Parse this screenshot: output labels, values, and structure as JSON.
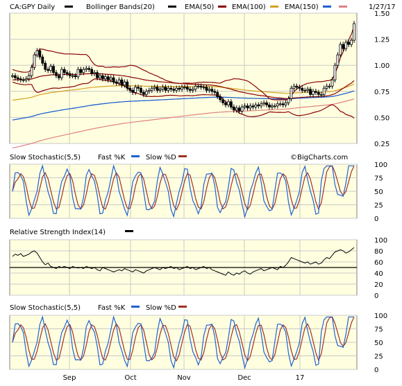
{
  "chart_data": {
    "type": "line",
    "symbol": "CA:GPY Daily",
    "date": "1/27/17",
    "watermark": "©BigCharts.com",
    "x_ticks": [
      "Sep",
      "Oct",
      "Nov",
      "Dec",
      "17"
    ],
    "panels": {
      "price": {
        "legend": [
          {
            "label": "CA:GPY Daily",
            "color": "#000000"
          },
          {
            "label": "Bollinger Bands(20)",
            "color": "#000000"
          },
          {
            "label": "EMA(50)",
            "color": "#8b0000"
          },
          {
            "label": "EMA(100)",
            "color": "#d4a020"
          },
          {
            "label": "EMA(150)",
            "color": "#2060d0"
          },
          {
            "label": "",
            "color": "#e08080"
          }
        ],
        "y_ticks": [
          "1.50",
          "1.25",
          "1.00",
          "0.75",
          "0.50",
          "0.25"
        ],
        "ylim": [
          0.25,
          1.5
        ],
        "close": [
          0.9,
          0.88,
          0.87,
          0.86,
          0.86,
          0.87,
          0.9,
          0.98,
          1.1,
          1.14,
          1.08,
          1.02,
          0.96,
          0.95,
          0.99,
          0.93,
          0.9,
          0.88,
          0.96,
          0.93,
          0.92,
          0.9,
          0.9,
          0.89,
          0.96,
          0.93,
          0.96,
          0.97,
          0.96,
          0.92,
          0.93,
          0.88,
          0.9,
          0.87,
          0.89,
          0.86,
          0.88,
          0.84,
          0.83,
          0.86,
          0.81,
          0.84,
          0.78,
          0.76,
          0.74,
          0.79,
          0.78,
          0.74,
          0.72,
          0.75,
          0.76,
          0.78,
          0.79,
          0.76,
          0.77,
          0.79,
          0.76,
          0.78,
          0.77,
          0.76,
          0.78,
          0.77,
          0.79,
          0.79,
          0.77,
          0.76,
          0.77,
          0.8,
          0.8,
          0.79,
          0.79,
          0.76,
          0.77,
          0.75,
          0.74,
          0.7,
          0.67,
          0.64,
          0.62,
          0.65,
          0.6,
          0.57,
          0.59,
          0.56,
          0.6,
          0.61,
          0.59,
          0.61,
          0.6,
          0.62,
          0.61,
          0.63,
          0.64,
          0.62,
          0.6,
          0.61,
          0.61,
          0.63,
          0.63,
          0.62,
          0.64,
          0.68,
          0.78,
          0.8,
          0.79,
          0.78,
          0.76,
          0.76,
          0.77,
          0.72,
          0.75,
          0.74,
          0.72,
          0.72,
          0.78,
          0.8,
          0.8,
          0.86,
          1.0,
          1.1,
          1.2,
          1.16,
          1.22,
          1.2,
          1.24,
          1.4
        ],
        "ema50": [
          0.86,
          0.861,
          0.861,
          0.862,
          0.862,
          0.863,
          0.864,
          0.868,
          0.876,
          0.885,
          0.893,
          0.898,
          0.901,
          0.904,
          0.908,
          0.909,
          0.909,
          0.909,
          0.911,
          0.912,
          0.912,
          0.912,
          0.912,
          0.911,
          0.913,
          0.914,
          0.916,
          0.918,
          0.919,
          0.919,
          0.919,
          0.918,
          0.918,
          0.916,
          0.915,
          0.913,
          0.912,
          0.909,
          0.906,
          0.904,
          0.9,
          0.898,
          0.893,
          0.888,
          0.882,
          0.878,
          0.874,
          0.868,
          0.862,
          0.858,
          0.854,
          0.851,
          0.849,
          0.845,
          0.842,
          0.84,
          0.837,
          0.835,
          0.833,
          0.83,
          0.828,
          0.826,
          0.825,
          0.823,
          0.821,
          0.819,
          0.817,
          0.816,
          0.816,
          0.815,
          0.814,
          0.812,
          0.811,
          0.809,
          0.806,
          0.802,
          0.797,
          0.79,
          0.783,
          0.778,
          0.77,
          0.762,
          0.755,
          0.747,
          0.742,
          0.737,
          0.731,
          0.726,
          0.722,
          0.717,
          0.712,
          0.709,
          0.706,
          0.702,
          0.698,
          0.694,
          0.691,
          0.688,
          0.686,
          0.683,
          0.681,
          0.68,
          0.682,
          0.686,
          0.689,
          0.69,
          0.693,
          0.694,
          0.696,
          0.697,
          0.698,
          0.699,
          0.7,
          0.701,
          0.704,
          0.707,
          0.711,
          0.718,
          0.728,
          0.743,
          0.762,
          0.779,
          0.797,
          0.813,
          0.829,
          0.853
        ]
      },
      "stoch_top": {
        "title": "Slow Stochastic(5,5)",
        "legend": [
          {
            "label": "Fast %K",
            "color": "#2060d0"
          },
          {
            "label": "Slow %D",
            "color": "#a03020"
          }
        ],
        "y_ticks": [
          "100",
          "75",
          "50",
          "25",
          "0"
        ],
        "ylim": [
          0,
          100
        ]
      },
      "rsi": {
        "title": "Relative Strength Index(14)",
        "legend": [
          {
            "label": "",
            "color": "#000000"
          }
        ],
        "y_ticks": [
          "100",
          "80",
          "60",
          "40",
          "20",
          "0"
        ],
        "ylim": [
          0,
          100
        ],
        "values": [
          70,
          74,
          72,
          75,
          70,
          72,
          74,
          78,
          80,
          76,
          68,
          60,
          55,
          58,
          52,
          50,
          48,
          52,
          50,
          52,
          50,
          48,
          52,
          50,
          49,
          50,
          48,
          52,
          50,
          48,
          50,
          46,
          44,
          50,
          48,
          46,
          44,
          42,
          44,
          46,
          44,
          48,
          46,
          44,
          42,
          46,
          44,
          42,
          40,
          44,
          46,
          48,
          50,
          48,
          46,
          50,
          48,
          50,
          52,
          48,
          50,
          46,
          48,
          50,
          52,
          48,
          50,
          46,
          48,
          50,
          52,
          48,
          50,
          46,
          44,
          42,
          40,
          38,
          36,
          42,
          38,
          36,
          40,
          38,
          42,
          44,
          40,
          38,
          42,
          44,
          46,
          48,
          44,
          46,
          48,
          50,
          48,
          46,
          52,
          50,
          54,
          60,
          68,
          66,
          64,
          62,
          60,
          58,
          60,
          56,
          58,
          60,
          56,
          58,
          64,
          68,
          66,
          72,
          78,
          80,
          82,
          80,
          76,
          78,
          82,
          86
        ],
        "reference_line": 50
      },
      "stoch_bottom": {
        "title": "Slow Stochastic(5,5)",
        "legend": [
          {
            "label": "Fast %K",
            "color": "#2060d0"
          },
          {
            "label": "Slow %D",
            "color": "#a03020"
          }
        ],
        "y_ticks": [
          "100",
          "75",
          "50",
          "25",
          "0"
        ],
        "ylim": [
          0,
          100
        ]
      }
    }
  }
}
